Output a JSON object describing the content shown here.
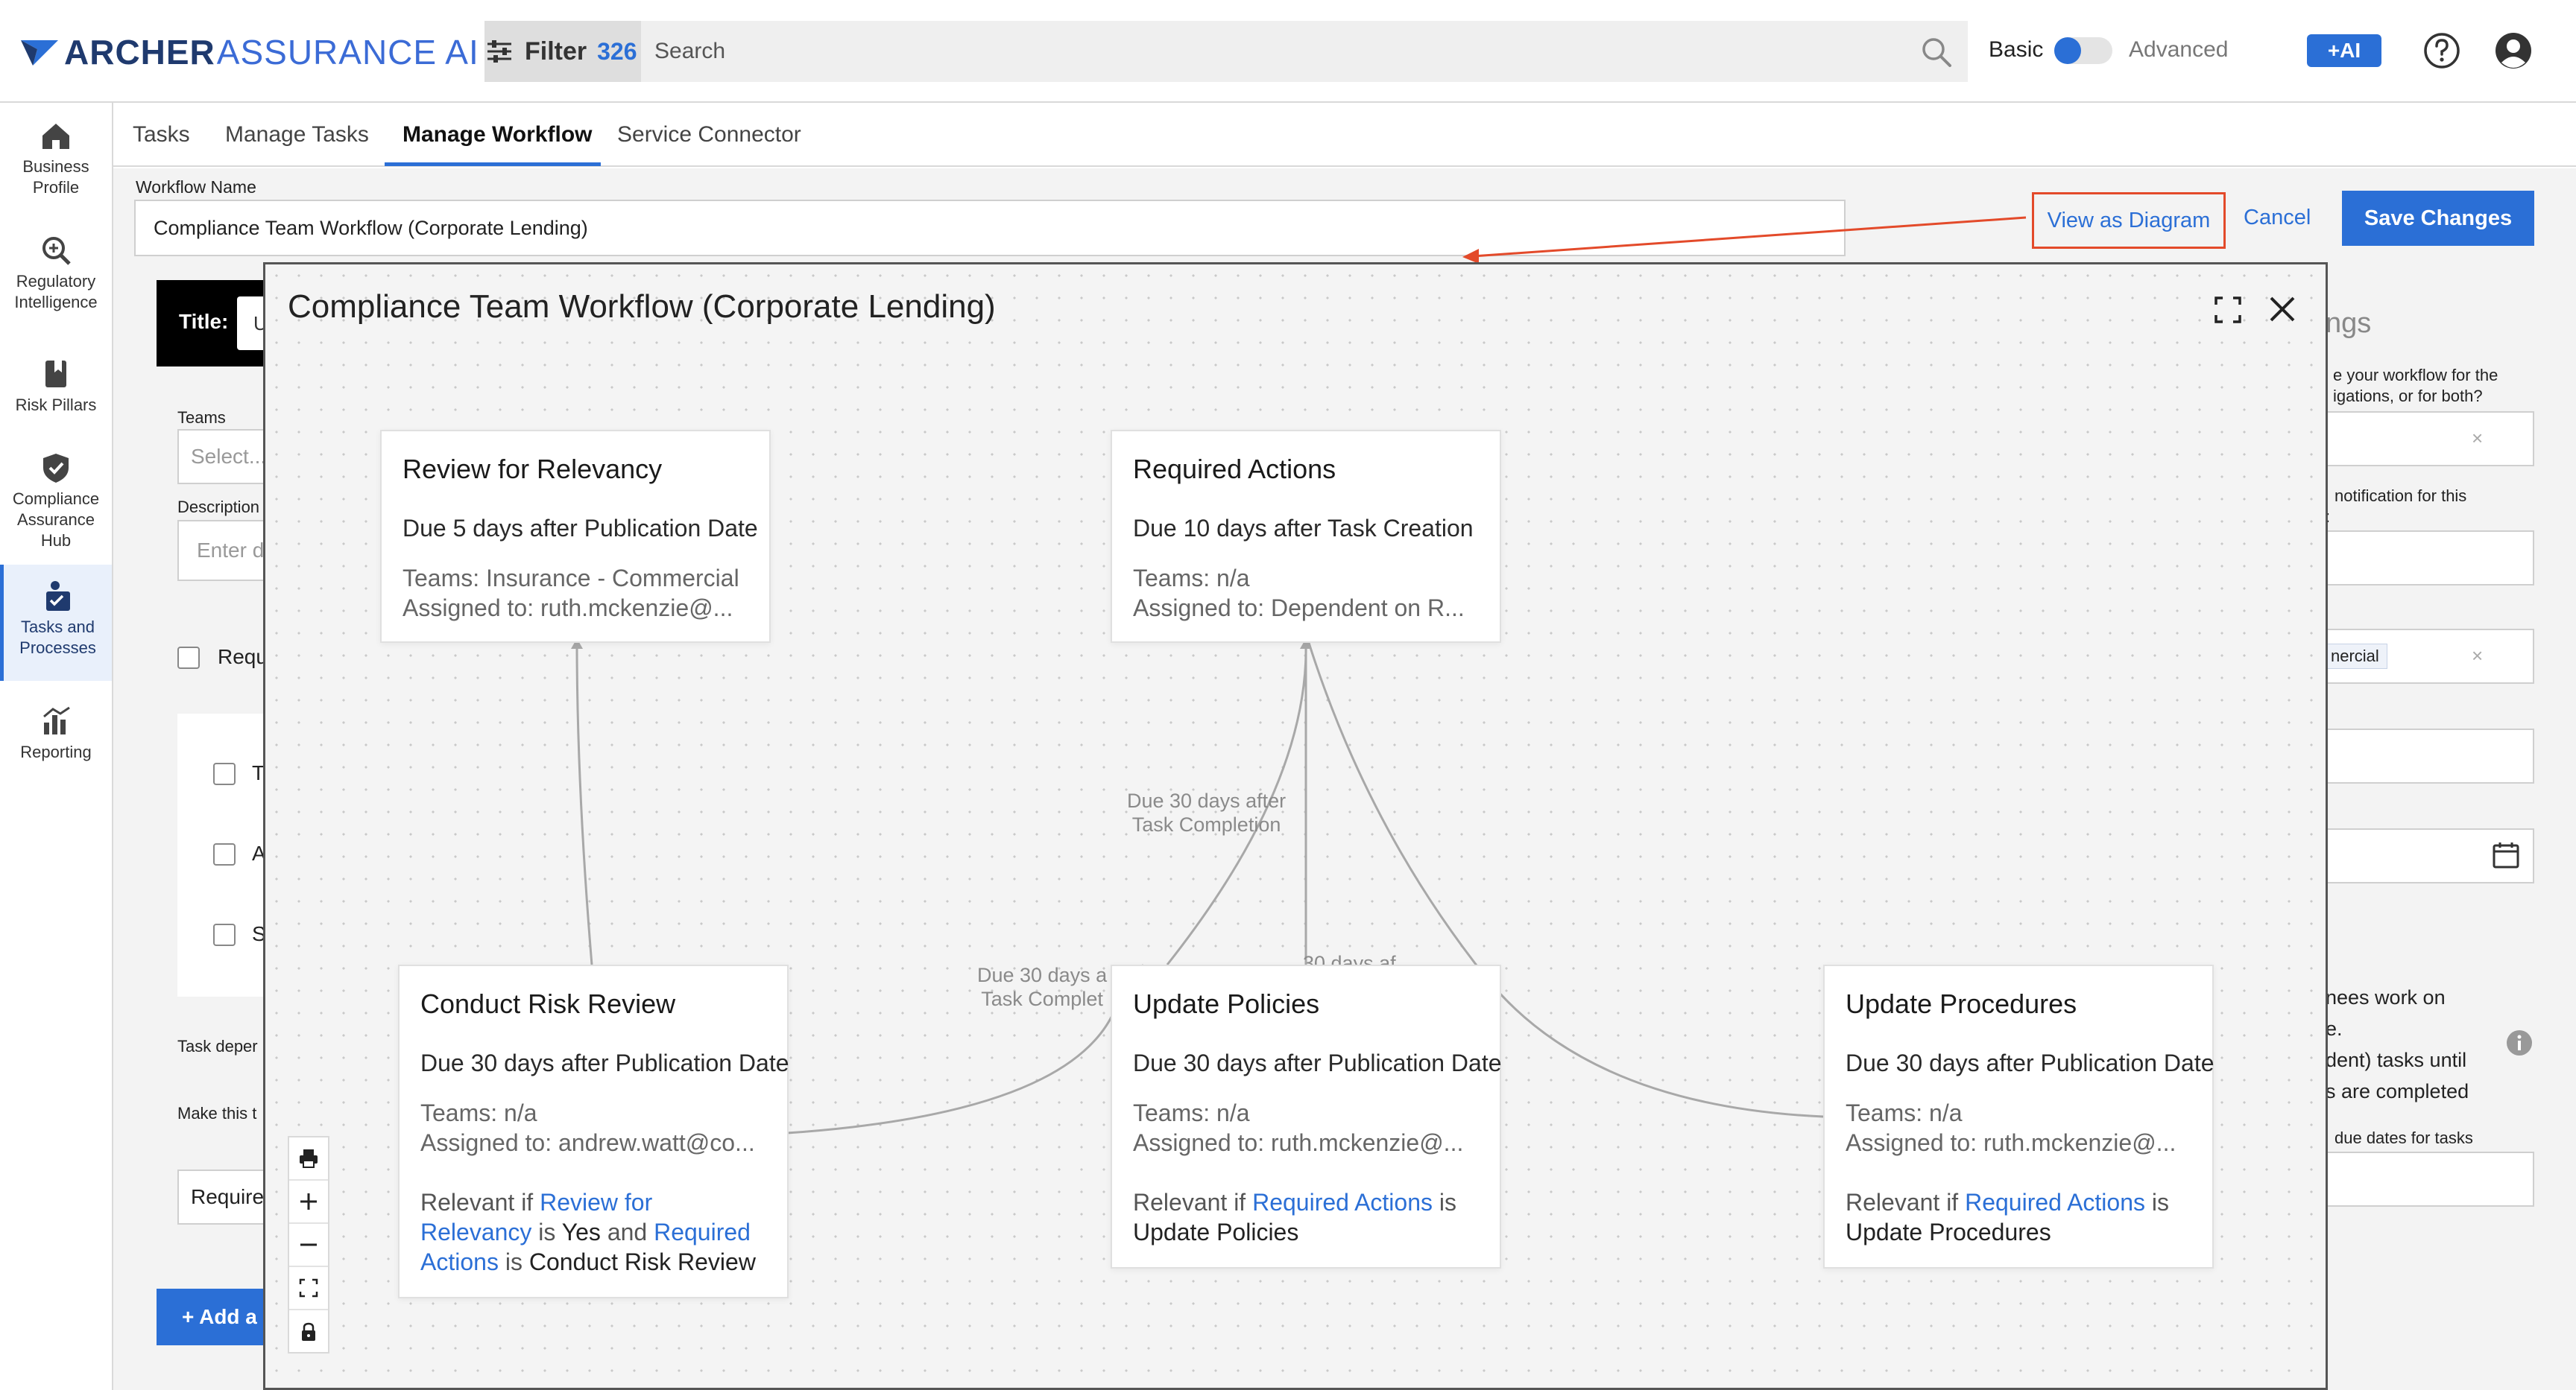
{
  "app": {
    "brand_primary": "ARCHER",
    "brand_secondary": "ASSURANCE AI",
    "accent_color": "#2b6fd6"
  },
  "topbar": {
    "filter_label": "Filter",
    "filter_count": "326",
    "search_placeholder": "Search",
    "mode_basic": "Basic",
    "mode_advanced": "Advanced",
    "ai_label": "+AI"
  },
  "nav": {
    "items": [
      {
        "label_1": "Business",
        "label_2": "Profile",
        "icon": "home-icon"
      },
      {
        "label_1": "Regulatory",
        "label_2": "Intelligence",
        "icon": "magnifier-plus-icon"
      },
      {
        "label_1": "Risk Pillars",
        "label_2": "",
        "icon": "bookmark-book-icon"
      },
      {
        "label_1": "Compliance",
        "label_2": "Assurance",
        "label_3": "Hub",
        "icon": "shield-check-icon"
      },
      {
        "label_1": "Tasks and",
        "label_2": "Processes",
        "icon": "tasks-icon"
      },
      {
        "label_1": "Reporting",
        "label_2": "",
        "icon": "chart-icon"
      }
    ]
  },
  "tabs": [
    "Tasks",
    "Manage Tasks",
    "Manage Workflow",
    "Service Connector"
  ],
  "workflow_form": {
    "name_label": "Workflow Name",
    "name_value": "Compliance Team Workflow (Corporate Lending)",
    "view_diagram": "View as Diagram",
    "cancel": "Cancel",
    "save": "Save Changes"
  },
  "background_form": {
    "title_label": "Title:",
    "title_value": "U",
    "teams_label": "Teams",
    "teams_placeholder": "Select...",
    "description_label": "Description",
    "description_placeholder": "Enter d",
    "required_check": "Requ",
    "check_t": "T",
    "check_a": "A",
    "check_s": "S",
    "task_depend": "Task deper",
    "make_this": "Make this t",
    "require_field": "Require",
    "add_button": "+ Add a",
    "right_heading": "ngs",
    "right_q1_a": "e your workflow for the",
    "right_q1_b": "igations, or for both?",
    "right_q2": "notification for this",
    "right_q2_b": ":",
    "right_tag": "nercial",
    "right_q3_a": "nees work on",
    "right_q3_b": "e.",
    "right_q3_c": "dent) tasks until",
    "right_q3_d": "s are completed",
    "right_q4": "due dates for tasks",
    "clear_mark": "×"
  },
  "modal": {
    "title": "Compliance Team Workflow (Corporate Lending)",
    "nodes": [
      {
        "title": "Review for Relevancy",
        "due": "Due 5 days after Publication Date",
        "teams": "Teams: Insurance - Commercial",
        "assigned": "Assigned to: ruth.mckenzie@..."
      },
      {
        "title": "Required Actions",
        "due": "Due 10 days after Task Creation",
        "teams": "Teams: n/a",
        "assigned": "Assigned to: Dependent on R..."
      },
      {
        "title": "Conduct Risk Review",
        "due": "Due 30 days after Publication Date",
        "teams": "Teams: n/a",
        "assigned": "Assigned to: andrew.watt@co...",
        "relevant_prefix": "Relevant if",
        "rel_link1": "Review for Relevancy",
        "rel_is1": "is",
        "rel_val1": "Yes",
        "rel_and": "and",
        "rel_link2": "Required Actions",
        "rel_is2": "is",
        "rel_val2": "Conduct Risk Review"
      },
      {
        "title": "Update Policies",
        "due": "Due 30 days after Publication Date",
        "teams": "Teams: n/a",
        "assigned": "Assigned to: ruth.mckenzie@...",
        "relevant_prefix": "Relevant if",
        "rel_link1": "Required Actions",
        "rel_is1": "is",
        "rel_val1": "Update Policies"
      },
      {
        "title": "Update Procedures",
        "due": "Due 30 days after Publication Date",
        "teams": "Teams: n/a",
        "assigned": "Assigned to: ruth.mckenzie@...",
        "relevant_prefix": "Relevant if",
        "rel_link1": "Required Actions",
        "rel_is1": "is",
        "rel_val1": "Update Procedures"
      }
    ],
    "edge_labels": {
      "e1_line1": "Due 30 days after",
      "e1_line2": "Task Completion",
      "e2_line1": "Due 30 days a",
      "e2_line2": "Task Complet",
      "e3": "30 days af"
    }
  }
}
